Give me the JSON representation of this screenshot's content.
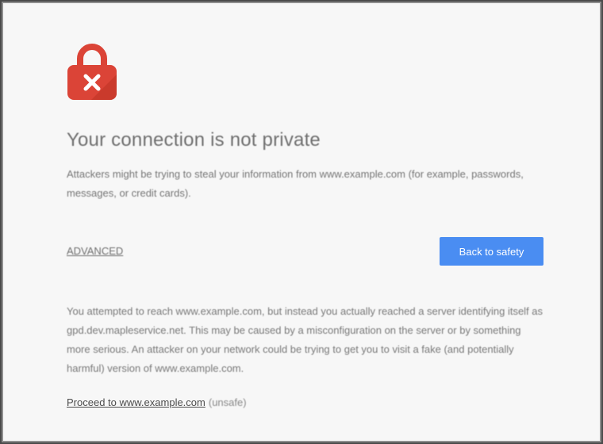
{
  "page": {
    "lock_icon": "lock-error-icon",
    "accent_color": "#4a8df2",
    "danger_color": "#db4437"
  },
  "title": "Your connection is not private",
  "summary": "Attackers might be trying to steal your information from www.example.com (for example, passwords, messages, or credit cards).",
  "advanced_link": "ADVANCED",
  "back_button": "Back to safety",
  "details": "You attempted to reach www.example.com, but instead you actually reached a server identifying itself as gpd.dev.mapleservice.net. This may be caused by a misconfiguration on the server or by something more serious. An attacker on your network could be trying to get you to visit a fake (and potentially harmful) version of www.example.com.",
  "proceed_link": "Proceed to www.example.com",
  "proceed_note": "(unsafe)"
}
